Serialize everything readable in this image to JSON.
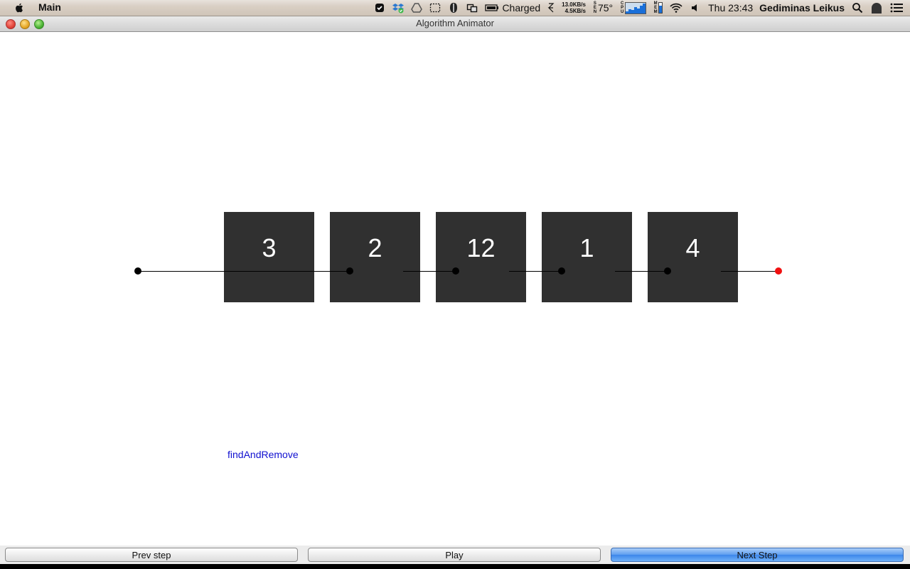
{
  "menubar": {
    "app_name": "Main",
    "battery_status": "Charged",
    "net_up": "13.0KB/s",
    "net_down": "4.5KB/s",
    "sensor_label": "SEN",
    "temperature": "75°",
    "cpu_label": "CPU",
    "mem_label": "MEM",
    "clock": "Thu 23:43",
    "user": "Gediminas Leikus"
  },
  "window": {
    "title": "Algorithm Animator"
  },
  "list": {
    "nodes": [
      "3",
      "2",
      "12",
      "1",
      "4"
    ]
  },
  "function_label": "findAndRemove",
  "buttons": {
    "prev": "Prev step",
    "play": "Play",
    "next": "Next Step"
  },
  "colors": {
    "node_fill": "#303030",
    "tail_dot": "#f01010",
    "function_label": "#1010d0",
    "primary_button": "#3d86ea"
  }
}
